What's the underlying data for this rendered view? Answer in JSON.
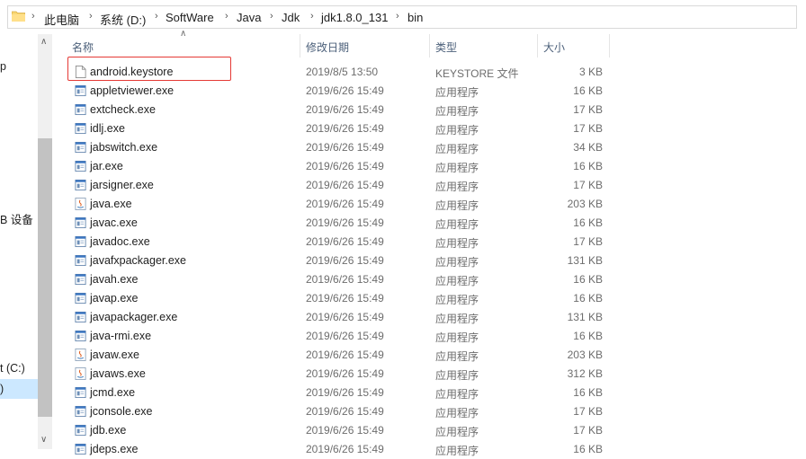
{
  "breadcrumb": [
    "此电脑",
    "系统 (D:)",
    "SoftWare",
    "Java",
    "Jdk",
    "jdk1.8.0_131",
    "bin"
  ],
  "nav": {
    "items": [
      "p",
      "B 设备",
      "t (C:)",
      ")"
    ]
  },
  "columns": {
    "name": "名称",
    "date": "修改日期",
    "type": "类型",
    "size": "大小"
  },
  "files": [
    {
      "name": "android.keystore",
      "date": "2019/8/5 13:50",
      "type": "KEYSTORE 文件",
      "size": "3 KB",
      "icon": "document-icon"
    },
    {
      "name": "appletviewer.exe",
      "date": "2019/6/26 15:49",
      "type": "应用程序",
      "size": "16 KB",
      "icon": "exe-icon"
    },
    {
      "name": "extcheck.exe",
      "date": "2019/6/26 15:49",
      "type": "应用程序",
      "size": "17 KB",
      "icon": "exe-icon"
    },
    {
      "name": "idlj.exe",
      "date": "2019/6/26 15:49",
      "type": "应用程序",
      "size": "17 KB",
      "icon": "exe-icon"
    },
    {
      "name": "jabswitch.exe",
      "date": "2019/6/26 15:49",
      "type": "应用程序",
      "size": "34 KB",
      "icon": "exe-icon"
    },
    {
      "name": "jar.exe",
      "date": "2019/6/26 15:49",
      "type": "应用程序",
      "size": "16 KB",
      "icon": "exe-icon"
    },
    {
      "name": "jarsigner.exe",
      "date": "2019/6/26 15:49",
      "type": "应用程序",
      "size": "17 KB",
      "icon": "exe-icon"
    },
    {
      "name": "java.exe",
      "date": "2019/6/26 15:49",
      "type": "应用程序",
      "size": "203 KB",
      "icon": "java-icon"
    },
    {
      "name": "javac.exe",
      "date": "2019/6/26 15:49",
      "type": "应用程序",
      "size": "16 KB",
      "icon": "exe-icon"
    },
    {
      "name": "javadoc.exe",
      "date": "2019/6/26 15:49",
      "type": "应用程序",
      "size": "17 KB",
      "icon": "exe-icon"
    },
    {
      "name": "javafxpackager.exe",
      "date": "2019/6/26 15:49",
      "type": "应用程序",
      "size": "131 KB",
      "icon": "exe-icon"
    },
    {
      "name": "javah.exe",
      "date": "2019/6/26 15:49",
      "type": "应用程序",
      "size": "16 KB",
      "icon": "exe-icon"
    },
    {
      "name": "javap.exe",
      "date": "2019/6/26 15:49",
      "type": "应用程序",
      "size": "16 KB",
      "icon": "exe-icon"
    },
    {
      "name": "javapackager.exe",
      "date": "2019/6/26 15:49",
      "type": "应用程序",
      "size": "131 KB",
      "icon": "exe-icon"
    },
    {
      "name": "java-rmi.exe",
      "date": "2019/6/26 15:49",
      "type": "应用程序",
      "size": "16 KB",
      "icon": "exe-icon"
    },
    {
      "name": "javaw.exe",
      "date": "2019/6/26 15:49",
      "type": "应用程序",
      "size": "203 KB",
      "icon": "java-icon"
    },
    {
      "name": "javaws.exe",
      "date": "2019/6/26 15:49",
      "type": "应用程序",
      "size": "312 KB",
      "icon": "java-icon"
    },
    {
      "name": "jcmd.exe",
      "date": "2019/6/26 15:49",
      "type": "应用程序",
      "size": "16 KB",
      "icon": "exe-icon"
    },
    {
      "name": "jconsole.exe",
      "date": "2019/6/26 15:49",
      "type": "应用程序",
      "size": "17 KB",
      "icon": "exe-icon"
    },
    {
      "name": "jdb.exe",
      "date": "2019/6/26 15:49",
      "type": "应用程序",
      "size": "17 KB",
      "icon": "exe-icon"
    },
    {
      "name": "jdeps.exe",
      "date": "2019/6/26 15:49",
      "type": "应用程序",
      "size": "16 KB",
      "icon": "exe-icon"
    }
  ],
  "colors": {
    "highlight": "#e53935",
    "header_text": "#4c607a",
    "selection": "#cce8ff"
  }
}
